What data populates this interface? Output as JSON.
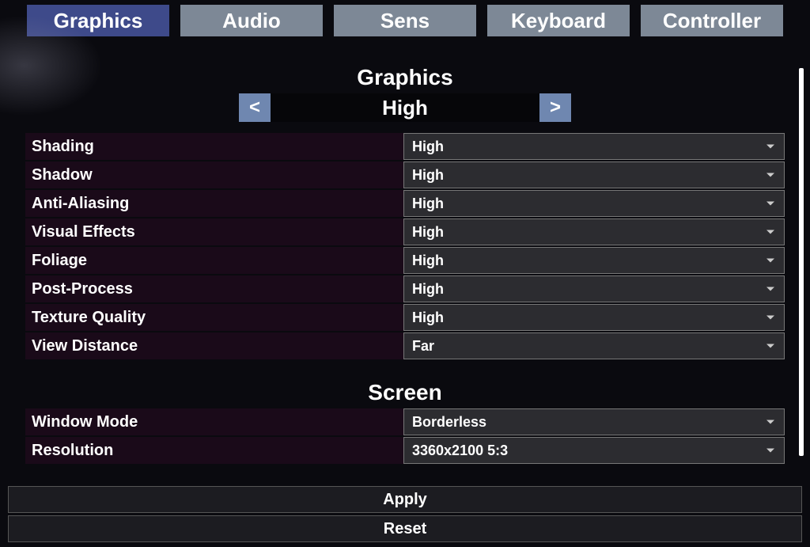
{
  "tabs": {
    "graphics": "Graphics",
    "audio": "Audio",
    "sens": "Sens",
    "keyboard": "Keyboard",
    "controller": "Controller"
  },
  "sections": {
    "graphics_title": "Graphics",
    "preset_value": "High",
    "preset_prev_glyph": "<",
    "preset_next_glyph": ">",
    "screen_title": "Screen"
  },
  "graphics_rows": {
    "shading": {
      "label": "Shading",
      "value": "High"
    },
    "shadow": {
      "label": "Shadow",
      "value": "High"
    },
    "anti_aliasing": {
      "label": "Anti-Aliasing",
      "value": "High"
    },
    "visual_effects": {
      "label": "Visual Effects",
      "value": "High"
    },
    "foliage": {
      "label": "Foliage",
      "value": "High"
    },
    "post_process": {
      "label": "Post-Process",
      "value": "High"
    },
    "texture_quality": {
      "label": "Texture Quality",
      "value": "High"
    },
    "view_distance": {
      "label": "View Distance",
      "value": "Far"
    }
  },
  "screen_rows": {
    "window_mode": {
      "label": "Window Mode",
      "value": "Borderless"
    },
    "resolution": {
      "label": "Resolution",
      "value": "3360x2100  5:3"
    }
  },
  "footer": {
    "apply": "Apply",
    "reset": "Reset"
  }
}
